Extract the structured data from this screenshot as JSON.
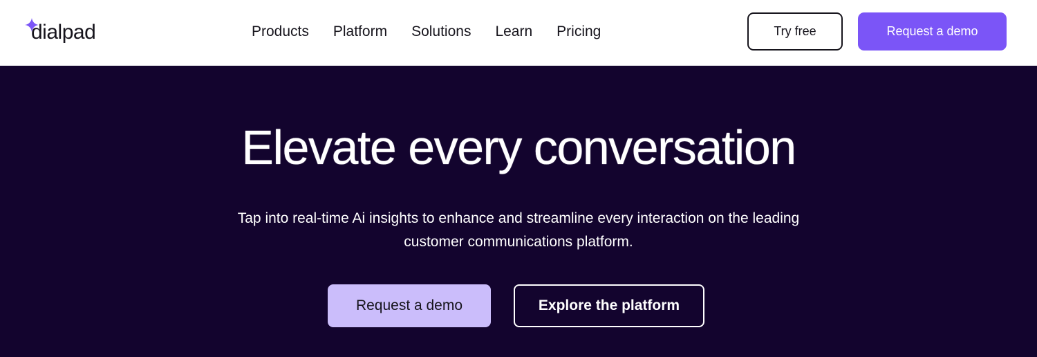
{
  "brand": {
    "logo_text": "dialpad",
    "logo_icon": "sparkle-icon",
    "accent_color": "#7b55f7"
  },
  "nav": {
    "items": [
      {
        "label": "Products"
      },
      {
        "label": "Platform"
      },
      {
        "label": "Solutions"
      },
      {
        "label": "Learn"
      },
      {
        "label": "Pricing"
      }
    ]
  },
  "header_actions": {
    "try_free_label": "Try free",
    "request_demo_label": "Request a demo"
  },
  "hero": {
    "title": "Elevate every conversation",
    "subtitle": "Tap into real-time Ai insights to enhance and streamline every interaction on the leading customer communications platform.",
    "primary_cta": "Request a demo",
    "secondary_cta": "Explore the platform",
    "background_color": "#13042e",
    "primary_cta_color": "#cbbdfb"
  }
}
